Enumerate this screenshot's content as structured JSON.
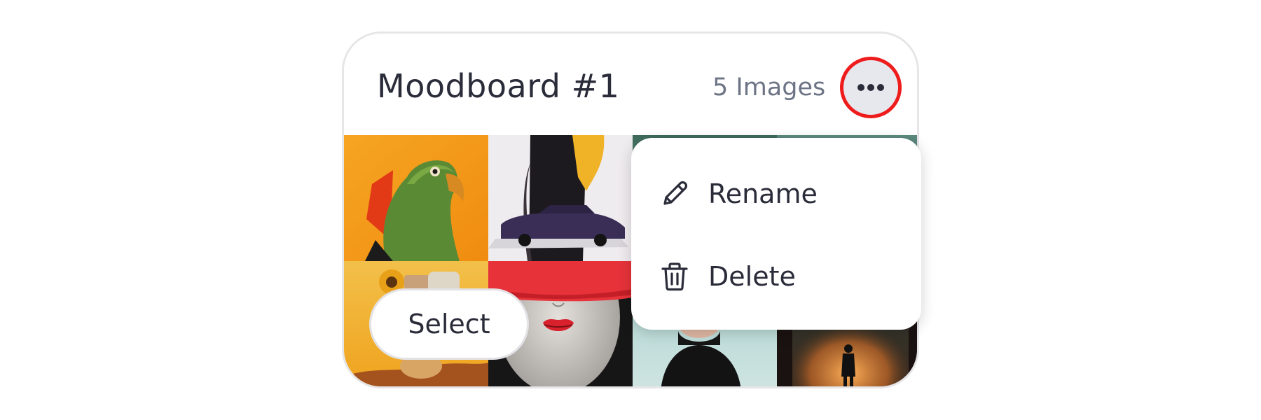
{
  "card": {
    "title": "Moodboard #1",
    "image_count": "5 Images",
    "more_button_icon": "more-horizontal-icon",
    "select_label": "Select"
  },
  "menu": {
    "items": [
      {
        "label": "Rename",
        "icon": "pencil-icon"
      },
      {
        "label": "Delete",
        "icon": "trash-icon"
      }
    ]
  },
  "colors": {
    "title_text": "#2b2c3a",
    "count_text": "#6d7485",
    "more_button_bg": "#e6e8ee",
    "highlight_ring": "#ee1c1c",
    "card_border": "#e6e6e8"
  }
}
